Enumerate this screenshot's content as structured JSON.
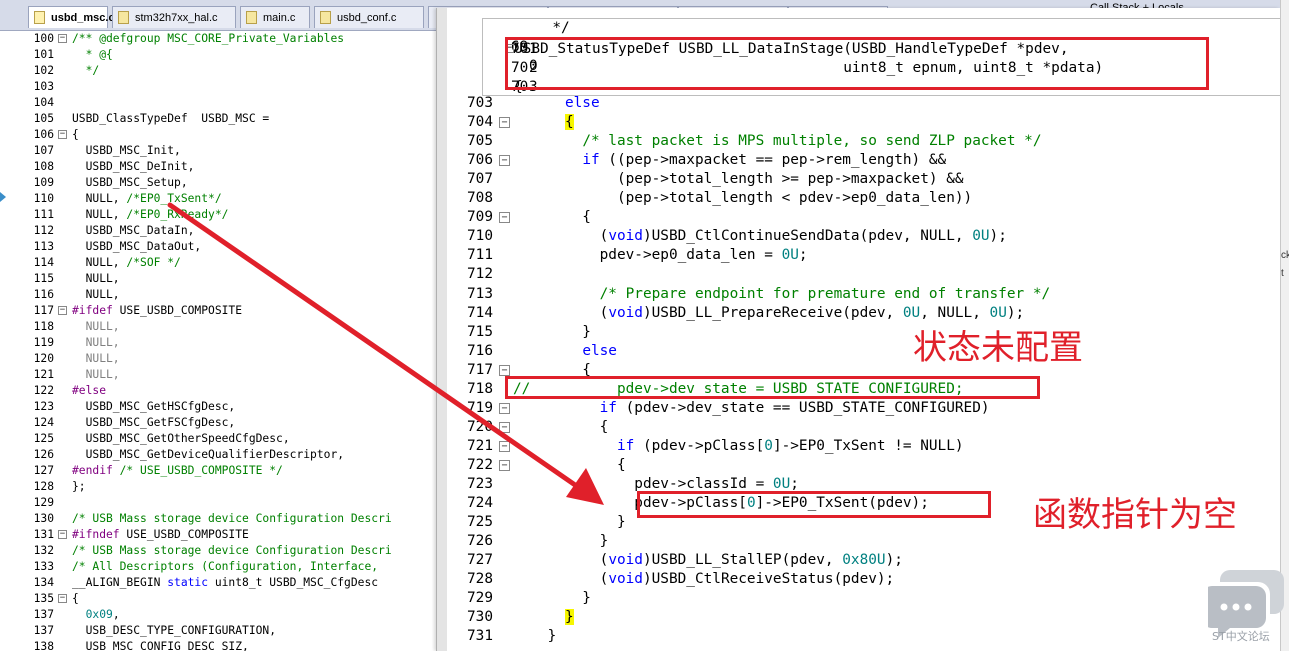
{
  "tabs": [
    {
      "label": "usbd_msc.c",
      "active": true
    },
    {
      "label": "stm32h7xx_hal.c",
      "active": false
    },
    {
      "label": "main.c",
      "active": false
    },
    {
      "label": "usbd_conf.c",
      "active": false
    }
  ],
  "right_panel_title": "Call Stack + Locals",
  "left_editor": {
    "lines": [
      {
        "n": "100",
        "fold": "−",
        "html": "<span class=\"cmt\">/** @defgroup MSC_CORE_Private_Variables</span>"
      },
      {
        "n": "101",
        "fold": "",
        "html": "<span class=\"cmt\">  * @{</span>"
      },
      {
        "n": "102",
        "fold": "",
        "html": "<span class=\"cmt\">  */</span>"
      },
      {
        "n": "103",
        "fold": "",
        "html": ""
      },
      {
        "n": "104",
        "fold": "",
        "html": ""
      },
      {
        "n": "105",
        "fold": "",
        "html": "USBD_ClassTypeDef  USBD_MSC ="
      },
      {
        "n": "106",
        "fold": "−",
        "html": "{"
      },
      {
        "n": "107",
        "fold": "",
        "html": "  USBD_MSC_Init,"
      },
      {
        "n": "108",
        "fold": "",
        "html": "  USBD_MSC_DeInit,"
      },
      {
        "n": "109",
        "fold": "",
        "html": "  USBD_MSC_Setup,"
      },
      {
        "n": "110",
        "fold": "",
        "html": "  NULL, <span class=\"cmt\">/*EP0_TxSent*/</span>"
      },
      {
        "n": "111",
        "fold": "",
        "html": "  NULL, <span class=\"cmt\">/*EP0_RxReady*/</span>"
      },
      {
        "n": "112",
        "fold": "",
        "html": "  USBD_MSC_DataIn,"
      },
      {
        "n": "113",
        "fold": "",
        "html": "  USBD_MSC_DataOut,"
      },
      {
        "n": "114",
        "fold": "",
        "html": "  NULL, <span class=\"cmt\">/*SOF */</span>"
      },
      {
        "n": "115",
        "fold": "",
        "html": "  NULL,"
      },
      {
        "n": "116",
        "fold": "",
        "html": "  NULL,"
      },
      {
        "n": "117",
        "fold": "−",
        "html": "<span class=\"pp\">#ifdef</span> USE_USBD_COMPOSITE"
      },
      {
        "n": "118",
        "fold": "",
        "html": "<span class=\"gray\">  NULL,</span>"
      },
      {
        "n": "119",
        "fold": "",
        "html": "<span class=\"gray\">  NULL,</span>"
      },
      {
        "n": "120",
        "fold": "",
        "html": "<span class=\"gray\">  NULL,</span>"
      },
      {
        "n": "121",
        "fold": "",
        "html": "<span class=\"gray\">  NULL,</span>"
      },
      {
        "n": "122",
        "fold": "",
        "html": "<span class=\"pp\">#else</span>"
      },
      {
        "n": "123",
        "fold": "",
        "html": "  USBD_MSC_GetHSCfgDesc,"
      },
      {
        "n": "124",
        "fold": "",
        "html": "  USBD_MSC_GetFSCfgDesc,"
      },
      {
        "n": "125",
        "fold": "",
        "html": "  USBD_MSC_GetOtherSpeedCfgDesc,"
      },
      {
        "n": "126",
        "fold": "",
        "html": "  USBD_MSC_GetDeviceQualifierDescriptor,"
      },
      {
        "n": "127",
        "fold": "",
        "html": "<span class=\"pp\">#endif</span> <span class=\"cmt\">/* USE_USBD_COMPOSITE */</span>"
      },
      {
        "n": "128",
        "fold": "",
        "html": "};"
      },
      {
        "n": "129",
        "fold": "",
        "html": ""
      },
      {
        "n": "130",
        "fold": "",
        "html": "<span class=\"cmt\">/* USB Mass storage device Configuration Descri</span>"
      },
      {
        "n": "131",
        "fold": "−",
        "html": "<span class=\"pp\">#ifndef</span> USE_USBD_COMPOSITE"
      },
      {
        "n": "132",
        "fold": "",
        "html": "<span class=\"cmt\">/* USB Mass storage device Configuration Descri</span>"
      },
      {
        "n": "133",
        "fold": "",
        "html": "<span class=\"cmt\">/* All Descriptors (Configuration, Interface,</span>"
      },
      {
        "n": "134",
        "fold": "",
        "html": "__ALIGN_BEGIN <span class=\"kw\">static</span> uint8_t USBD_MSC_CfgDesc"
      },
      {
        "n": "135",
        "fold": "−",
        "html": "{"
      },
      {
        "n": "137",
        "fold": "",
        "html": "  <span class=\"num\">0x09</span>,"
      },
      {
        "n": "137",
        "fold": "",
        "html": "  USB_DESC_TYPE_CONFIGURATION,"
      },
      {
        "n": "138",
        "fold": "",
        "html": "  USB_MSC_CONFIG_DESC_SIZ,"
      }
    ]
  },
  "popup": {
    "line1_num": "69",
    "line1_code": "  */",
    "decl_num_a": "70",
    "decl_num_b": "70",
    "decl_num_c": "70",
    "decl_digits": [
      "0",
      "1",
      "2",
      "3"
    ],
    "decl_line1": "USBD_StatusTypeDef USBD_LL_DataInStage(USBD_HandleTypeDef *pdev,",
    "decl_line2": "                                      uint8_t epnum, uint8_t *pdata)",
    "decl_line3": "{"
  },
  "right_editor": {
    "lines": [
      {
        "n": "703",
        "fold": "",
        "html": "      <span class=\"kw\">else</span>"
      },
      {
        "n": "704",
        "fold": "−",
        "html": "      <span class=\"hl\">{</span>"
      },
      {
        "n": "705",
        "fold": "",
        "html": "        <span class=\"cmt\">/* last packet is MPS multiple, so send ZLP packet */</span>"
      },
      {
        "n": "706",
        "fold": "−",
        "html": "        <span class=\"kw\">if</span> ((pep->maxpacket == pep->rem_length) &amp;&amp;"
      },
      {
        "n": "707",
        "fold": "",
        "html": "            (pep->total_length >= pep->maxpacket) &amp;&amp;"
      },
      {
        "n": "708",
        "fold": "",
        "html": "            (pep->total_length &lt; pdev->ep0_data_len))"
      },
      {
        "n": "709",
        "fold": "−",
        "html": "        {"
      },
      {
        "n": "710",
        "fold": "",
        "html": "          (<span class=\"kw\">void</span>)USBD_CtlContinueSendData(pdev, NULL, <span class=\"num\">0U</span>);"
      },
      {
        "n": "711",
        "fold": "",
        "html": "          pdev->ep0_data_len = <span class=\"num\">0U</span>;"
      },
      {
        "n": "712",
        "fold": "",
        "html": ""
      },
      {
        "n": "713",
        "fold": "",
        "html": "          <span class=\"cmt\">/* Prepare endpoint for premature end of transfer */</span>"
      },
      {
        "n": "714",
        "fold": "",
        "html": "          (<span class=\"kw\">void</span>)USBD_LL_PrepareReceive(pdev, <span class=\"num\">0U</span>, NULL, <span class=\"num\">0U</span>);"
      },
      {
        "n": "715",
        "fold": "",
        "html": "        }"
      },
      {
        "n": "716",
        "fold": "",
        "html": "        <span class=\"kw\">else</span>"
      },
      {
        "n": "717",
        "fold": "−",
        "html": "        {"
      },
      {
        "n": "718",
        "fold": "",
        "html": "<span class=\"cmt\">//          pdev->dev_state = USBD_STATE_CONFIGURED;</span>"
      },
      {
        "n": "719",
        "fold": "−",
        "html": "          <span class=\"kw\">if</span> (pdev->dev_state == USBD_STATE_CONFIGURED)"
      },
      {
        "n": "720",
        "fold": "−",
        "html": "          {"
      },
      {
        "n": "721",
        "fold": "−",
        "html": "            <span class=\"kw\">if</span> (pdev->pClass[<span class=\"num\">0</span>]->EP0_TxSent != NULL)"
      },
      {
        "n": "722",
        "fold": "−",
        "html": "            {"
      },
      {
        "n": "723",
        "fold": "",
        "html": "              pdev->classId = <span class=\"num\">0U</span>;"
      },
      {
        "n": "724",
        "fold": "",
        "html": "              pdev->pClass[<span class=\"num\">0</span>]->EP0_TxSent(pdev);"
      },
      {
        "n": "725",
        "fold": "",
        "html": "            }"
      },
      {
        "n": "726",
        "fold": "",
        "html": "          }"
      },
      {
        "n": "727",
        "fold": "",
        "html": "          (<span class=\"kw\">void</span>)USBD_LL_StallEP(pdev, <span class=\"num\">0x80U</span>);"
      },
      {
        "n": "728",
        "fold": "",
        "html": "          (<span class=\"kw\">void</span>)USBD_CtlReceiveStatus(pdev);"
      },
      {
        "n": "729",
        "fold": "",
        "html": "        }"
      },
      {
        "n": "730",
        "fold": "",
        "html": "      <span class=\"hl\">}</span>"
      },
      {
        "n": "731",
        "fold": "",
        "html": "    }"
      }
    ]
  },
  "annotations": {
    "state_not_configured": "状态未配置",
    "fn_pointer_null": "函数指针为空",
    "color": "#e0202a"
  },
  "edge_chars": [
    "ck",
    "t"
  ],
  "watermark": "ST中文论坛"
}
